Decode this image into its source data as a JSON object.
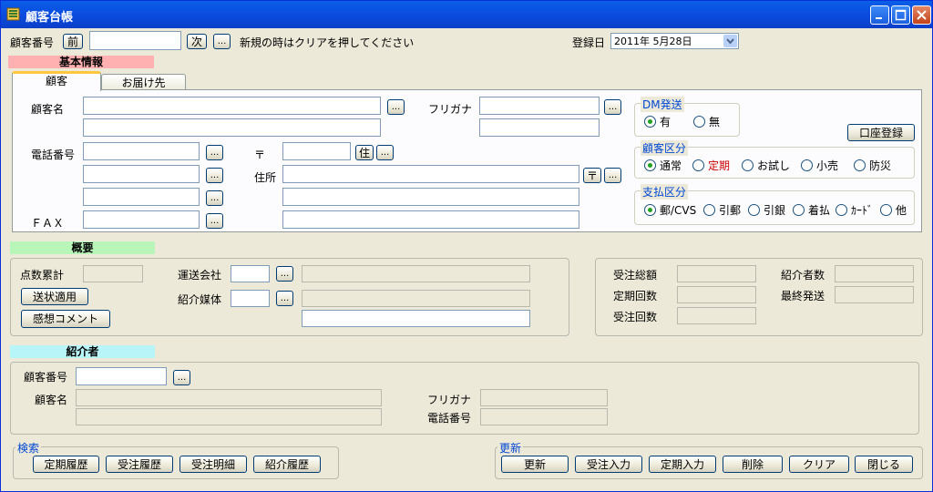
{
  "window": {
    "title": "顧客台帳"
  },
  "top": {
    "customer_no_label": "顧客番号",
    "prev_label": "前",
    "customer_no_value": "",
    "next_label": "次",
    "dots_label": "...",
    "hint": "新規の時はクリアを押してください",
    "reg_date_label": "登録日",
    "reg_date_value": "2011年 5月28日"
  },
  "basic": {
    "section_label": "基本情報",
    "tabs": [
      {
        "label": "顧客"
      },
      {
        "label": "お届け先"
      }
    ],
    "name_label": "顧客名",
    "furigana_label": "フリガナ",
    "phone_label": "電話番号",
    "postal_label": "〒",
    "jusho_btn": "住",
    "address_label": "住所",
    "postal_btn": "〒",
    "fax_label": "ＦＡＸ",
    "account_btn": "口座登録",
    "dm": {
      "caption": "DM発送",
      "options": [
        "有",
        "無"
      ],
      "selected": 0
    },
    "customer_type": {
      "caption": "顧客区分",
      "options": [
        "通常",
        "定期",
        "お試し",
        "小売",
        "防災"
      ],
      "selected": 0,
      "highlight_color": "#cc0000"
    },
    "payment": {
      "caption": "支払区分",
      "options": [
        "郵/CVS",
        "引郵",
        "引銀",
        "着払",
        "ｶｰﾄﾞ",
        "他"
      ],
      "selected": 0
    }
  },
  "overview": {
    "section_label": "概要",
    "points_label": "点数累計",
    "send_btn": "送状適用",
    "comment_btn": "感想コメント",
    "carrier_label": "運送会社",
    "media_label": "紹介媒体",
    "total_label": "受注総額",
    "regular_count_label": "定期回数",
    "order_count_label": "受注回数",
    "referrals_label": "紹介者数",
    "last_ship_label": "最終発送"
  },
  "referrer": {
    "section_label": "紹介者",
    "customer_no_label": "顧客番号",
    "name_label": "顧客名",
    "furigana_label": "フリガナ",
    "phone_label": "電話番号"
  },
  "search": {
    "caption": "検索",
    "buttons": [
      "定期履歴",
      "受注履歴",
      "受注明細",
      "紹介履歴"
    ]
  },
  "update": {
    "caption": "更新",
    "buttons": [
      "更新",
      "受注入力",
      "定期入力",
      "削除",
      "クリア",
      "閉じる"
    ]
  },
  "colors": {
    "titlebar": "#0a4de0",
    "basic_section": "#ffb0b0",
    "overview_section": "#b8f5b8",
    "referrer_section": "#b8f5f8",
    "caption": "#0046d5"
  }
}
